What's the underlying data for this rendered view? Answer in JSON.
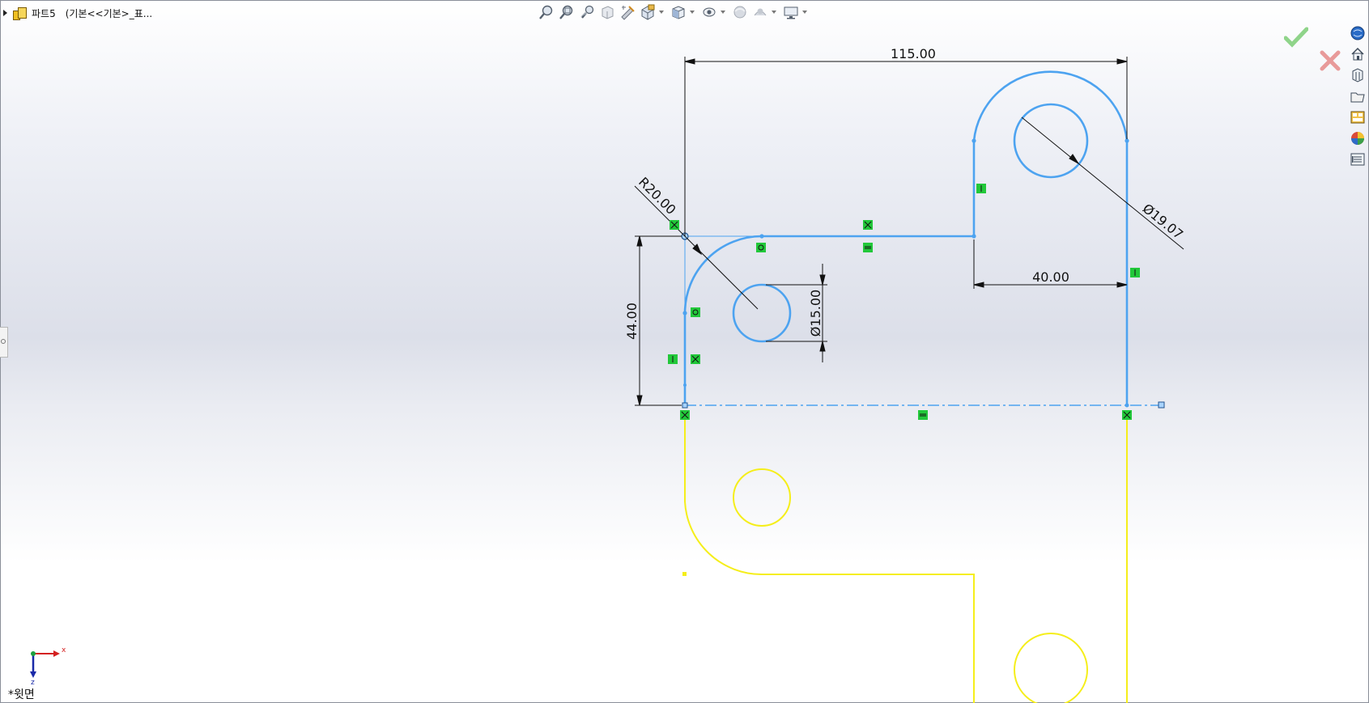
{
  "feature_tree": {
    "part_name": "파트5",
    "config_label": "(기본<<기본>_표..."
  },
  "view": {
    "orientation_label": "*윗면"
  },
  "dimensions": {
    "overall_width": "115.00",
    "slot_width": "40.00",
    "height": "44.00",
    "fillet_radius": "R20.00",
    "small_hole_dia": "Ø15.00",
    "large_hole_dia": "Ø19.07"
  },
  "triad": {
    "x_label": "x",
    "z_label": "z"
  },
  "hud_toolbar": {
    "icons": [
      "zoom-to-fit-icon",
      "zoom-to-area-icon",
      "previous-view-icon",
      "section-view-icon",
      "dynamic-annotation-icon",
      "view-orientation-icon",
      "display-style-icon",
      "hide-show-items-icon",
      "edit-appearance-icon",
      "apply-scene-icon",
      "view-settings-icon"
    ]
  },
  "task_pane": {
    "icons": [
      "solidworks-resources-icon",
      "home-icon",
      "design-library-icon",
      "file-explorer-icon",
      "view-palette-icon",
      "appearances-icon",
      "custom-properties-icon"
    ]
  },
  "colors": {
    "sketch_blue": "#4da3f0",
    "mirror_yellow": "#f5ee1a",
    "relation_green": "#22c83a",
    "ok_green": "#8fd48a",
    "cancel_red": "#e89a9a"
  }
}
